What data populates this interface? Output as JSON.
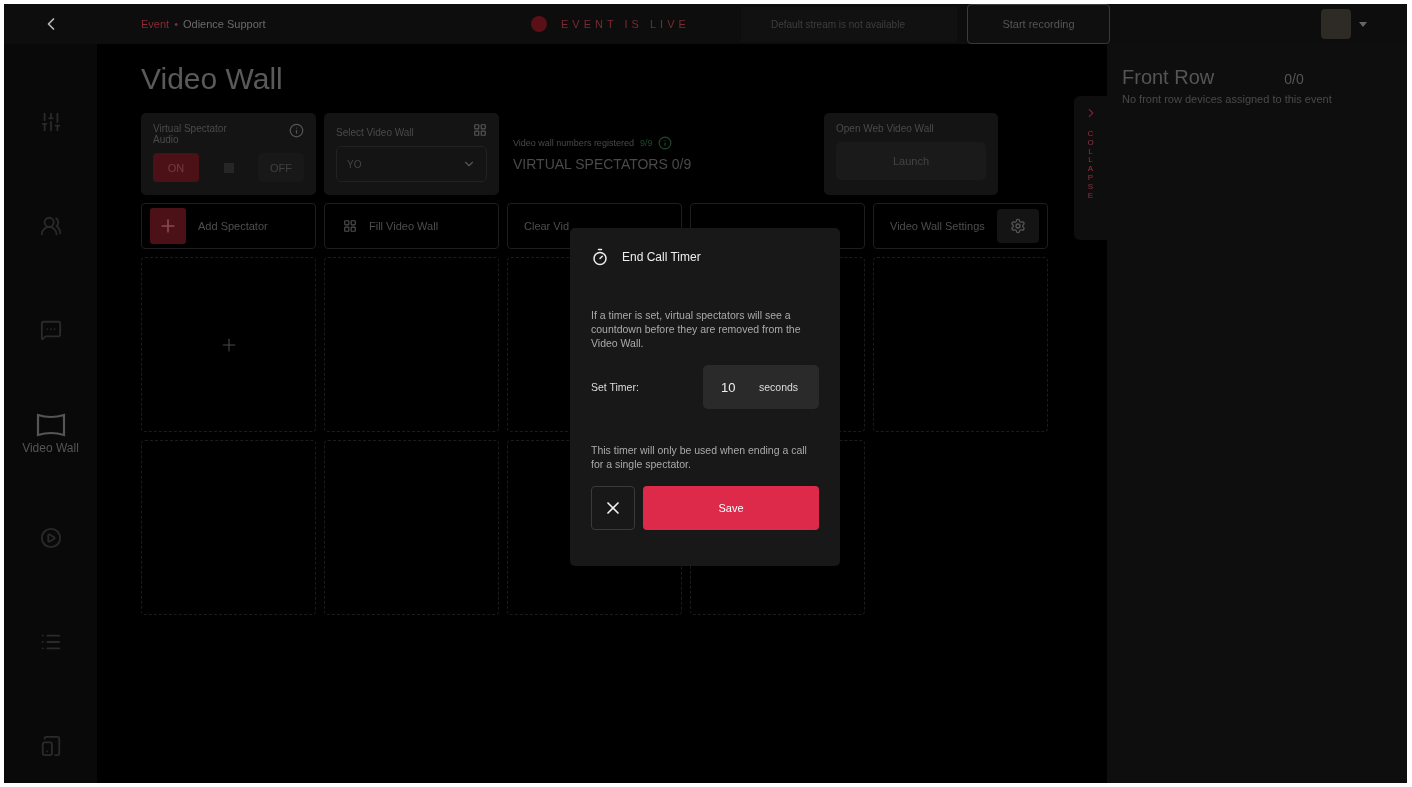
{
  "top_bar": {
    "breadcrumb": [
      "Event",
      "Odience Support"
    ],
    "separator": "•",
    "live_status": "EVENT IS LIVE",
    "stream_status": "Default stream is not available",
    "record_button": "Start recording"
  },
  "sidebar": {
    "items": [
      {
        "kind": "sliders",
        "selected": false
      },
      {
        "kind": "users",
        "selected": false
      },
      {
        "kind": "chat",
        "selected": false
      },
      {
        "kind": "wall",
        "label": "Video Wall",
        "selected": true
      },
      {
        "kind": "broadcast",
        "selected": false
      },
      {
        "kind": "list",
        "selected": false
      },
      {
        "kind": "device",
        "selected": false
      }
    ]
  },
  "page_title": "Video Wall",
  "audio_card": {
    "title": "Virtual Spectator Audio",
    "options": [
      {
        "label": "ON",
        "selected": true
      },
      {
        "label": "OFF",
        "selected": false
      }
    ]
  },
  "select_card": {
    "title": "Select Video Wall",
    "value": "YO"
  },
  "registration": {
    "label": "Video wall numbers registered",
    "count": "9/9",
    "summary": "VIRTUAL SPECTATORS 0/9"
  },
  "launch_card": {
    "title": "Open Web Video Wall",
    "button": "Launch"
  },
  "actions": [
    {
      "kind": "add",
      "label": "Add Spectator"
    },
    {
      "kind": "fill",
      "label": "Fill Video Wall"
    },
    {
      "kind": "plain",
      "label": "Clear Vid"
    },
    {
      "kind": "hidden"
    },
    {
      "kind": "settings",
      "label": "Video Wall Settings"
    }
  ],
  "tiles": [
    {
      "kind": "add"
    },
    {
      "kind": "empty"
    },
    {
      "kind": "empty"
    },
    {
      "kind": "empty"
    },
    {
      "kind": "empty"
    },
    {
      "kind": "empty"
    },
    {
      "kind": "empty"
    },
    {
      "kind": "empty"
    },
    {
      "kind": "empty"
    }
  ],
  "collapse_tab": {
    "label": "COLLAPSE"
  },
  "front_row": {
    "title": "Front Row",
    "count": "0/0",
    "message": "No front row devices assigned to this event"
  },
  "modal": {
    "title": "End Call Timer",
    "description": "If a timer is set, virtual spectators will see a countdown before they are removed from the Video Wall.",
    "timer_label": "Set Timer:",
    "timer_value": "10",
    "timer_unit": "seconds",
    "note": "This timer will only be used when ending a call for a single spectator.",
    "save_button": "Save"
  }
}
